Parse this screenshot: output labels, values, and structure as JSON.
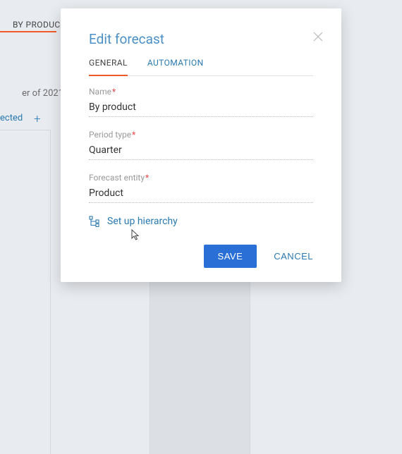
{
  "bg": {
    "tab_label": "BY PRODUC",
    "period_label": "er of 2021",
    "expected_label": "ected"
  },
  "modal": {
    "title": "Edit forecast",
    "tabs": {
      "general": "GENERAL",
      "automation": "AUTOMATION"
    },
    "fields": {
      "name_label": "Name",
      "name_value": "By product",
      "period_label": "Period type",
      "period_value": "Quarter",
      "entity_label": "Forecast entity",
      "entity_value": "Product"
    },
    "hierarchy_link": "Set up hierarchy",
    "actions": {
      "save": "SAVE",
      "cancel": "CANCEL"
    }
  }
}
